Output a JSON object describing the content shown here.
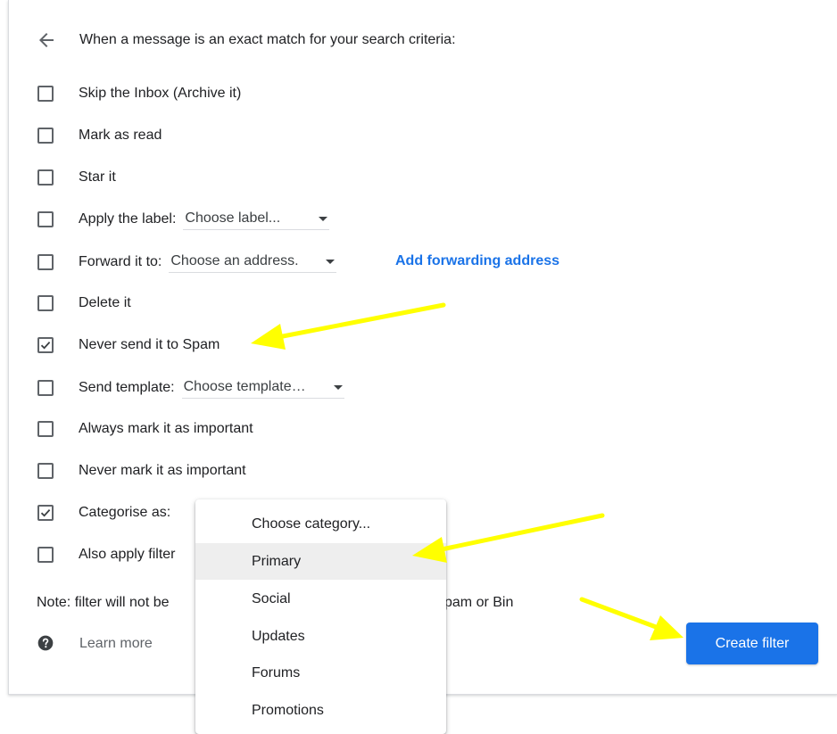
{
  "header": {
    "text": "When a message is an exact match for your search criteria:",
    "back_icon": "back-arrow-icon"
  },
  "options": [
    {
      "label": "Skip the Inbox (Archive it)",
      "checked": false
    },
    {
      "label": "Mark as read",
      "checked": false
    },
    {
      "label": "Star it",
      "checked": false
    },
    {
      "label": "Apply the label:",
      "checked": false,
      "dropdown": "Choose label..."
    },
    {
      "label": "Forward it to:",
      "checked": false,
      "dropdown": "Choose an address."
    },
    {
      "label": "Delete it",
      "checked": false
    },
    {
      "label": "Never send it to Spam",
      "checked": true
    },
    {
      "label": "Send template:",
      "checked": false,
      "dropdown": "Choose template…"
    },
    {
      "label": "Always mark it as important",
      "checked": false
    },
    {
      "label": "Never mark it as important",
      "checked": false
    },
    {
      "label": "Categorise as:",
      "checked": true
    },
    {
      "label": "Also apply filter",
      "checked": false
    }
  ],
  "forwarding_link": "Add forwarding address",
  "note": {
    "start": "Note: filter will not be",
    "end": "pam or Bin"
  },
  "learn_more": "Learn more",
  "create_filter_label": "Create filter",
  "category_menu": {
    "items": [
      "Choose category...",
      "Primary",
      "Social",
      "Updates",
      "Forums",
      "Promotions"
    ],
    "highlighted": "Primary"
  },
  "colors": {
    "accent": "#1a73e8",
    "annotation_arrow": "#ffff00",
    "menu_highlight": "#eeeeee"
  }
}
